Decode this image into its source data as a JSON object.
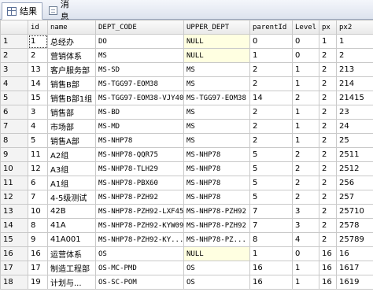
{
  "tabs": [
    {
      "label": "结果",
      "icon": "grid-icon"
    },
    {
      "label": "消息",
      "icon": "message-icon"
    }
  ],
  "columns": [
    "",
    "id",
    "name",
    "DEPT_CODE",
    "UPPER_DEPT",
    "parentId",
    "Level",
    "px",
    "px2"
  ],
  "rows": [
    [
      "1",
      "1",
      "总经办",
      "DO",
      "NULL",
      "0",
      "0",
      "1",
      "1"
    ],
    [
      "2",
      "2",
      "营销体系",
      "MS",
      "NULL",
      "1",
      "0",
      "2",
      "2"
    ],
    [
      "3",
      "13",
      "客户服务部",
      "MS-SD",
      "MS",
      "2",
      "1",
      "2",
      "213"
    ],
    [
      "4",
      "14",
      "销售B部",
      "MS-TGG97-EOM38",
      "MS",
      "2",
      "1",
      "2",
      "214"
    ],
    [
      "5",
      "15",
      "销售B部1组",
      "MS-TGG97-EOM38-VJY40",
      "MS-TGG97-EOM38",
      "14",
      "2",
      "2",
      "21415"
    ],
    [
      "6",
      "3",
      "销售部",
      "MS-BD",
      "MS",
      "2",
      "1",
      "2",
      "23"
    ],
    [
      "7",
      "4",
      "市场部",
      "MS-MD",
      "MS",
      "2",
      "1",
      "2",
      "24"
    ],
    [
      "8",
      "5",
      "销售A部",
      "MS-NHP78",
      "MS",
      "2",
      "1",
      "2",
      "25"
    ],
    [
      "9",
      "11",
      "A2组",
      "MS-NHP78-QQR75",
      "MS-NHP78",
      "5",
      "2",
      "2",
      "2511"
    ],
    [
      "10",
      "12",
      "A3组",
      "MS-NHP78-TLH29",
      "MS-NHP78",
      "5",
      "2",
      "2",
      "2512"
    ],
    [
      "11",
      "6",
      "A1组",
      "MS-NHP78-PBX60",
      "MS-NHP78",
      "5",
      "2",
      "2",
      "256"
    ],
    [
      "12",
      "7",
      "4-5级测试",
      "MS-NHP78-PZH92",
      "MS-NHP78",
      "5",
      "2",
      "2",
      "257"
    ],
    [
      "13",
      "10",
      "42B",
      "MS-NHP78-PZH92-LXF45",
      "MS-NHP78-PZH92",
      "7",
      "3",
      "2",
      "25710"
    ],
    [
      "14",
      "8",
      "41A",
      "MS-NHP78-PZH92-KYW09",
      "MS-NHP78-PZH92",
      "7",
      "3",
      "2",
      "2578"
    ],
    [
      "15",
      "9",
      "41A001",
      "MS-NHP78-PZH92-KY...",
      "MS-NHP78-PZ...",
      "8",
      "4",
      "2",
      "25789"
    ],
    [
      "16",
      "16",
      "运营体系",
      "OS",
      "NULL",
      "1",
      "0",
      "16",
      "16"
    ],
    [
      "17",
      "17",
      "制造工程部",
      "OS-MC-PMD",
      "OS",
      "16",
      "1",
      "16",
      "1617"
    ],
    [
      "18",
      "19",
      "计划与...",
      "OS-SC-POM",
      "OS",
      "16",
      "1",
      "16",
      "1619"
    ]
  ]
}
